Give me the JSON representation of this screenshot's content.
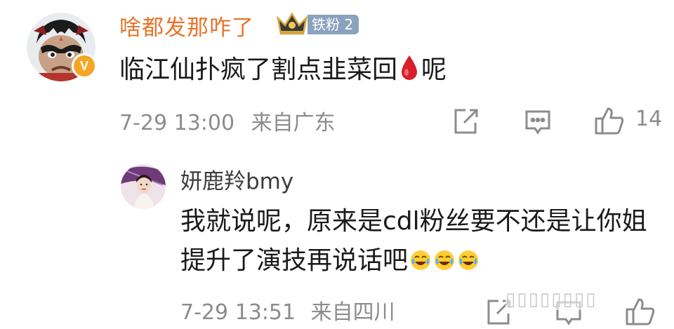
{
  "colors": {
    "username_orange": "#e8742a",
    "fan_badge": "#8aa2bd",
    "meta_gray": "#8c8c8c",
    "verified_orange": "#f5a623"
  },
  "main_comment": {
    "username": "啥都发那咋了",
    "fan_badge": "铁粉 2",
    "verified_badge": "V",
    "text_before_icon": "临江仙扑疯了割点韭菜回",
    "inline_icon": "blood-drop-icon",
    "text_after_icon": "呢",
    "timestamp": "7-29 13:00",
    "location": "来自广东",
    "like_count": "14"
  },
  "reply": {
    "username": "妍鹿羚bmy",
    "text": "我就说呢，原来是cdl粉丝要不还是让你姐提升了演技再说话吧",
    "trailing_emojis": [
      "laugh-cry-icon",
      "laugh-cry-icon",
      "laugh-cry-icon"
    ],
    "timestamp": "7-29 13:51",
    "location": "来自四川"
  },
  "watermark": "▯▯▯▯▯▯▯▯"
}
